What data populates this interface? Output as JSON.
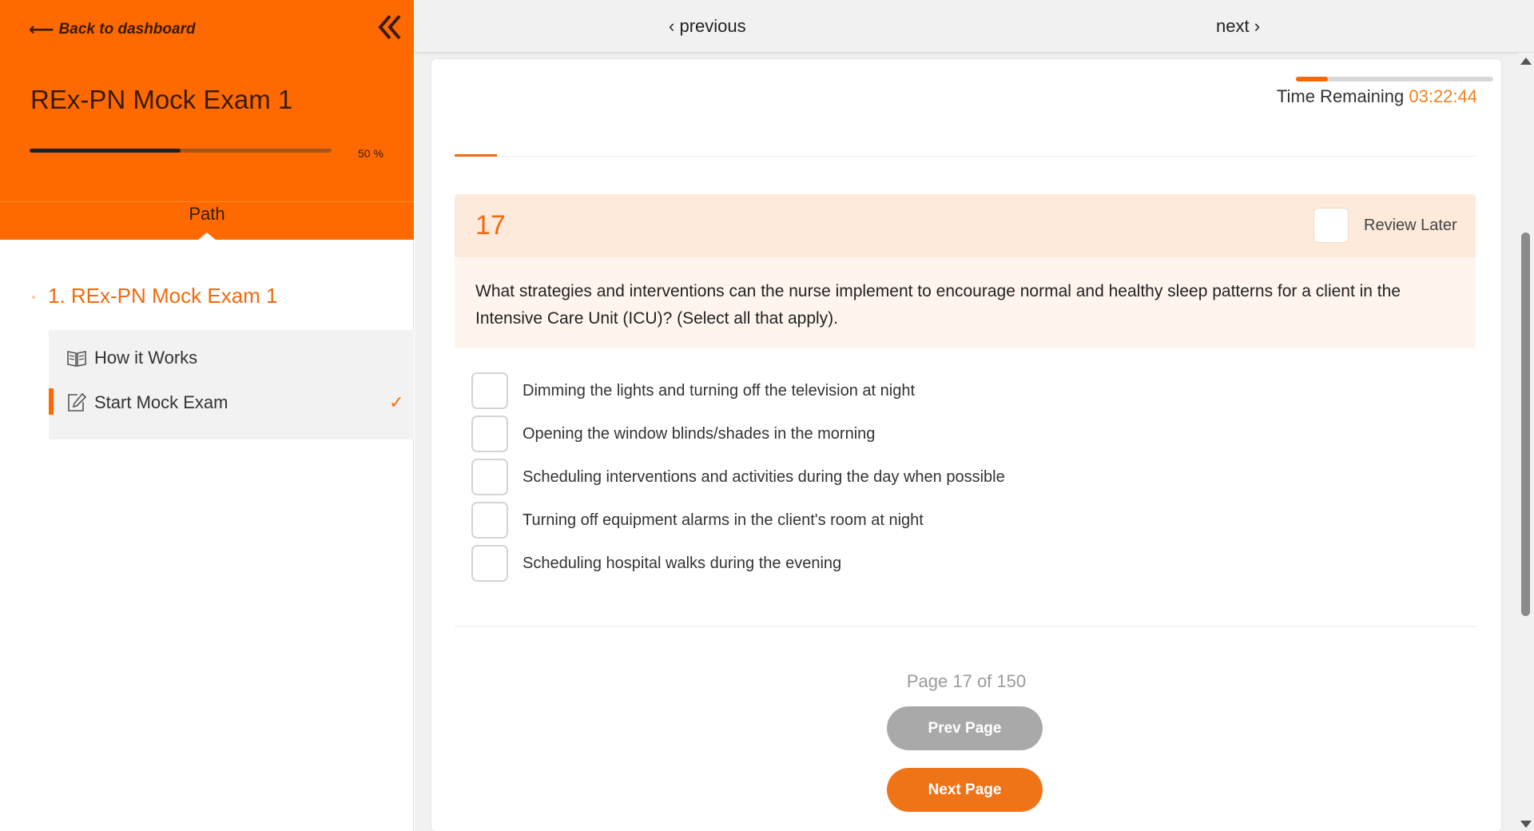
{
  "sidebar": {
    "back_label": "Back to dashboard",
    "exam_title": "REx-PN Mock Exam 1",
    "progress": {
      "value": 0.5,
      "label": "50 %"
    },
    "path_tab": "Path",
    "section_title": "1. REx-PN Mock Exam 1",
    "lessons": [
      {
        "label": "How it Works",
        "icon": "book-icon",
        "active": false,
        "completed": false
      },
      {
        "label": "Start Mock Exam",
        "icon": "edit-icon",
        "active": true,
        "completed": true,
        "check": "✓"
      }
    ]
  },
  "topbar": {
    "previous_label": "previous",
    "next_label": "next"
  },
  "timer": {
    "label": "Time Remaining",
    "value": "03:22:44",
    "elapsed_fraction": 0.16
  },
  "question": {
    "number": "17",
    "review_label": "Review Later",
    "text": "What strategies and interventions can the nurse implement to encourage normal and healthy sleep patterns for a client in the Intensive Care Unit (ICU)? (Select all that apply).",
    "options": [
      "Dimming the lights and turning off the television at night",
      "Opening the window blinds/shades in the morning",
      "Scheduling interventions and activities during the day when possible",
      "Turning off equipment alarms in the client's room at night",
      "Scheduling hospital walks during the evening"
    ]
  },
  "pagination": {
    "page_info": "Page 17 of 150",
    "prev_label": "Prev Page",
    "next_label": "Next Page"
  },
  "colors": {
    "accent": "#ff6a00",
    "accent_text": "#f06a10",
    "button_disabled": "#a9a9a9"
  }
}
